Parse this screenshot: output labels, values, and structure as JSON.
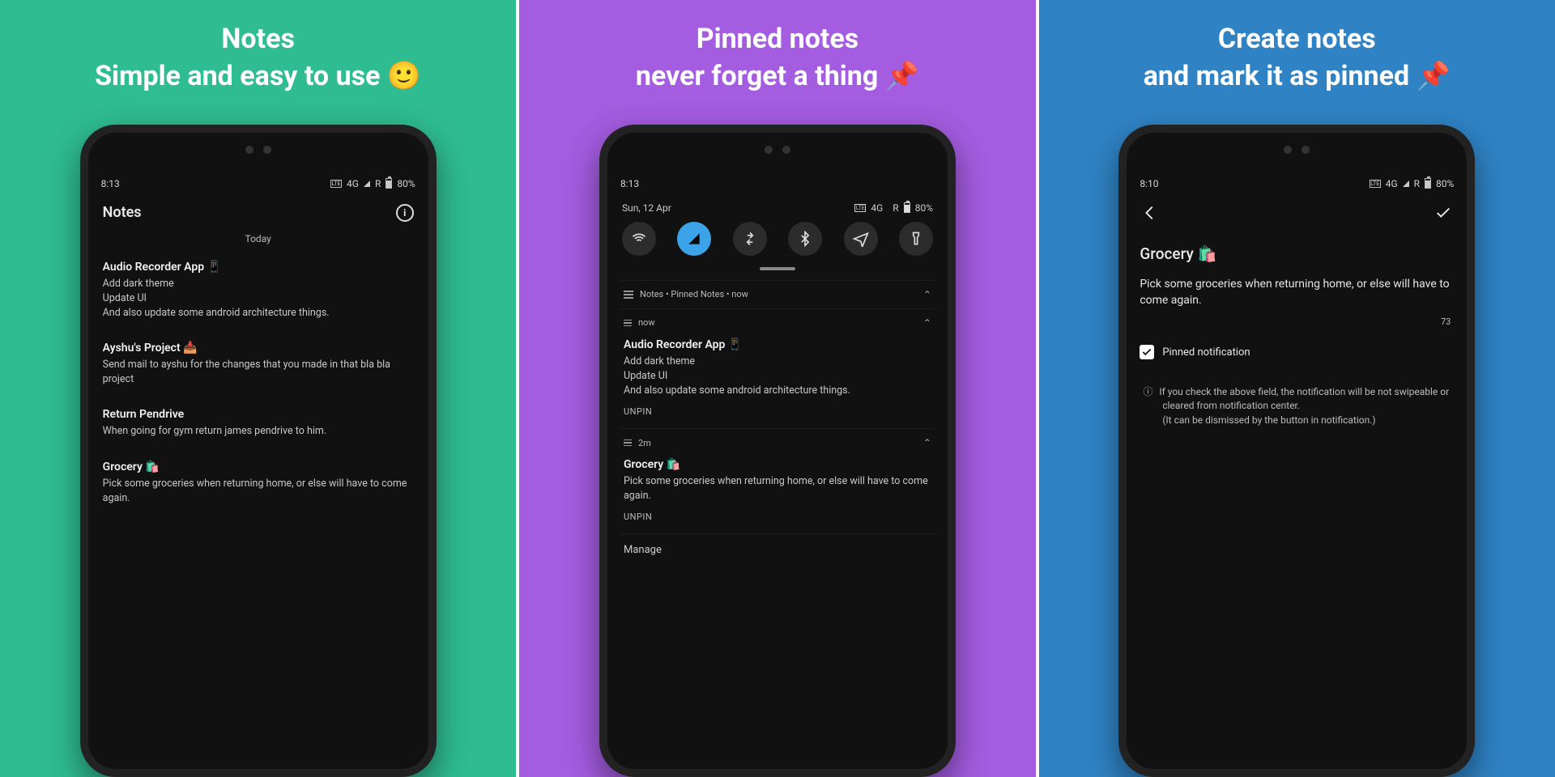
{
  "panels": [
    {
      "bg": "green",
      "title": "Notes\nSimple and easy to use 🙂"
    },
    {
      "bg": "purple",
      "title": "Pinned notes\nnever forget a thing 📌"
    },
    {
      "bg": "blue",
      "title": "Create notes\nand mark it as pinned 📌"
    }
  ],
  "statusbar": {
    "time_list": "8:13",
    "time_create": "8:10",
    "net": "4G",
    "roam": "R",
    "battery": "80%"
  },
  "p1": {
    "header": "Notes",
    "section": "Today",
    "notes": [
      {
        "title": "Audio Recorder App 📱",
        "body": "Add dark theme\nUpdate UI\nAnd also update some android architecture things."
      },
      {
        "title": "Ayshu's Project 📥",
        "body": "Send mail to ayshu for the changes that you made in that bla bla project"
      },
      {
        "title": "Return Pendrive",
        "body": "When going for gym return james pendrive to him."
      },
      {
        "title": "Grocery 🛍️",
        "body": "Pick some groceries when returning home, or else will have to come again."
      }
    ]
  },
  "p2": {
    "time": "8:13",
    "date": "Sun, 12 Apr",
    "notif_group": "Notes • Pinned Notes • now",
    "items": [
      {
        "ts": "now",
        "title": "Audio Recorder App 📱",
        "body": "Add dark theme\nUpdate UI\nAnd also update some android architecture things.",
        "action": "UNPIN"
      },
      {
        "ts": "2m",
        "title": "Grocery 🛍️",
        "body": "Pick some groceries when returning home, or else will have to come again.",
        "action": "UNPIN"
      }
    ],
    "manage": "Manage"
  },
  "p3": {
    "title": "Grocery 🛍️",
    "body": "Pick some groceries when returning home, or else will have to come again.",
    "char_count": "73",
    "checkbox_label": "Pinned notification",
    "hint": "If you check the above field, the notification will be not swipeable or cleared from notification center.\n(It can be dismissed by the button in notification.)"
  }
}
